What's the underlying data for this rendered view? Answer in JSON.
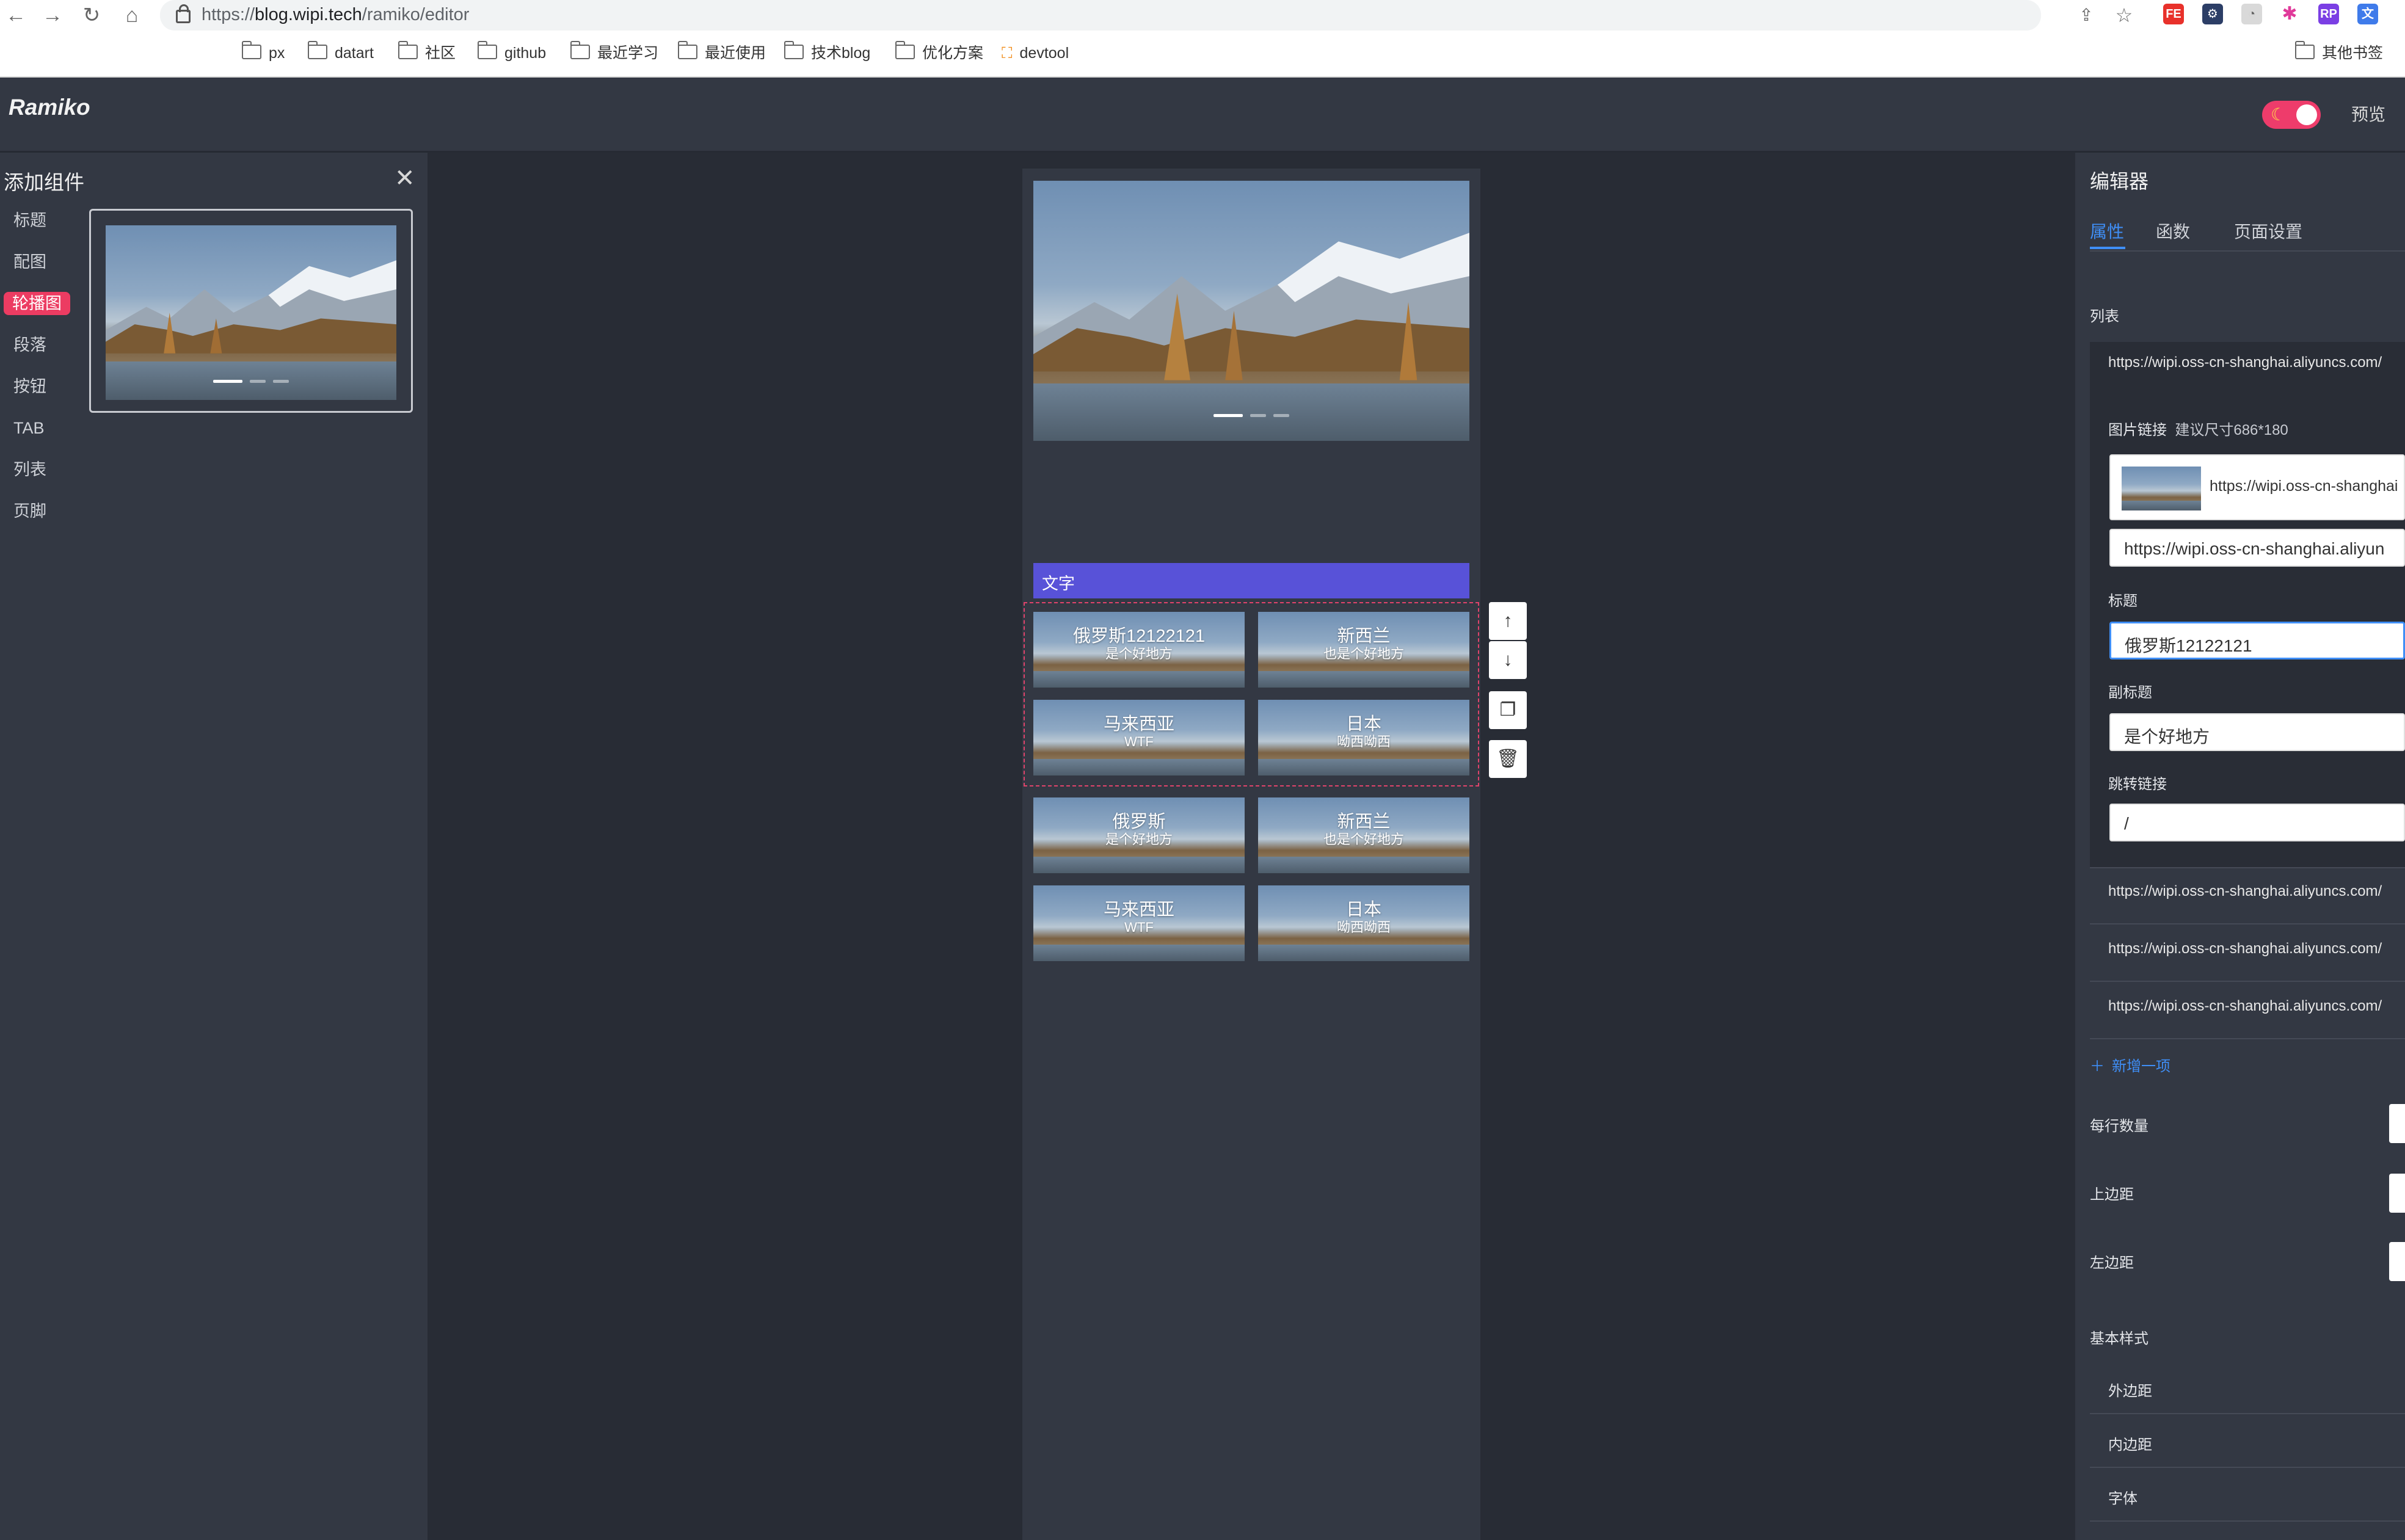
{
  "browser": {
    "url_prefix": "https://",
    "url_domain": "blog.wipi.tech",
    "url_path": "/ramiko/editor",
    "bookmarks": [
      "px",
      "datart",
      "社区",
      "github",
      "最近学习",
      "最近使用",
      "技术blog",
      "优化方案",
      "devtool"
    ],
    "other_bookmarks": "其他书签"
  },
  "app": {
    "logo": "Ramiko",
    "preview_label": "预览",
    "theme_toggle_on": true,
    "accent_color": "#ec3c62"
  },
  "left_panel": {
    "title": "添加组件",
    "categories": [
      "标题",
      "配图",
      "轮播图",
      "段落",
      "按钮",
      "TAB",
      "列表",
      "页脚"
    ],
    "active_category": "轮播图"
  },
  "canvas": {
    "text_bar_label": "文字",
    "grid_cells": [
      {
        "title": "俄罗斯12122121",
        "subtitle": "是个好地方"
      },
      {
        "title": "新西兰",
        "subtitle": "也是个好地方"
      },
      {
        "title": "马来西亚",
        "subtitle": "WTF"
      },
      {
        "title": "日本",
        "subtitle": "呦西呦西"
      },
      {
        "title": "俄罗斯",
        "subtitle": "是个好地方"
      },
      {
        "title": "新西兰",
        "subtitle": "也是个好地方"
      },
      {
        "title": "马来西亚",
        "subtitle": "WTF"
      },
      {
        "title": "日本",
        "subtitle": "呦西呦西"
      }
    ]
  },
  "editor": {
    "title": "编辑器",
    "tabs": [
      "属性",
      "函数",
      "页面设置"
    ],
    "active_tab": "属性",
    "list_label": "列表",
    "items": [
      "https://wipi.oss-cn-shanghai.aliyuncs.com/",
      "https://wipi.oss-cn-shanghai.aliyuncs.com/",
      "https://wipi.oss-cn-shanghai.aliyuncs.com/",
      "https://wipi.oss-cn-shanghai.aliyuncs.com/"
    ],
    "image_link_label": "图片链接",
    "image_link_hint": "建议尺寸686*180",
    "image_upload_url": "https://wipi.oss-cn-shanghai",
    "image_link_value": "https://wipi.oss-cn-shanghai.aliyun",
    "title_label": "标题",
    "title_value": "俄罗斯12122121",
    "subtitle_label": "副标题",
    "subtitle_value": "是个好地方",
    "link_label": "跳转链接",
    "link_value": "/",
    "add_item_label": "新增一项",
    "per_row_label": "每行数量",
    "top_margin_label": "上边距",
    "left_margin_label": "左边距",
    "basic_style_label": "基本样式",
    "style_sections": [
      "外边距",
      "内边距",
      "字体"
    ]
  }
}
